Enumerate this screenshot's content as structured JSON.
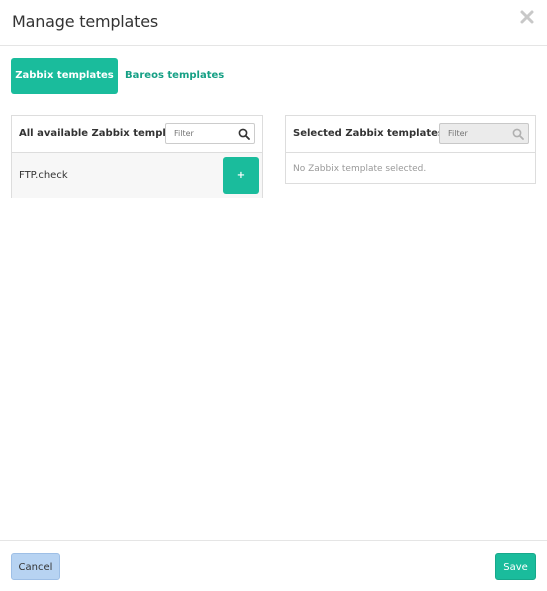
{
  "modal": {
    "title": "Manage templates"
  },
  "tabs": [
    {
      "label": "Zabbix templates",
      "active": true
    },
    {
      "label": "Bareos templates",
      "active": false
    }
  ],
  "available_panel": {
    "title": "All available Zabbix templates",
    "filter_placeholder": "Filter",
    "items": [
      {
        "label": "FTP.check",
        "action_label": "+"
      }
    ]
  },
  "selected_panel": {
    "title": "Selected Zabbix templates",
    "filter_placeholder": "Filter",
    "empty_text": "No Zabbix template selected."
  },
  "footer": {
    "cancel_label": "Cancel",
    "save_label": "Save"
  },
  "colors": {
    "accent": "#1abc9c",
    "cancel_bg": "#b7d3f2"
  },
  "icons": {
    "close": "close-icon",
    "search": "search-icon"
  }
}
